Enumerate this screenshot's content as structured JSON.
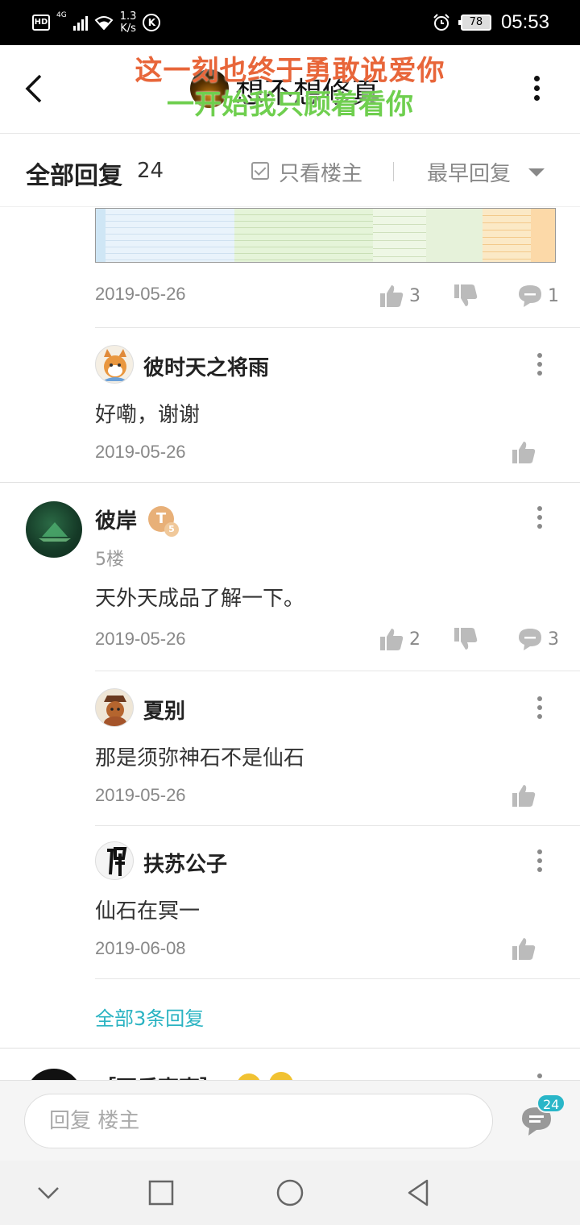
{
  "status_bar": {
    "hd": "HD",
    "network": "4G",
    "speed_value": "1.3",
    "speed_unit": "K/s",
    "k_icon": "K",
    "battery": "78",
    "time": "05:53"
  },
  "header": {
    "title": "想不想修真",
    "lyric_line1": "这一刻也终于勇敢说爱你",
    "lyric_line2": "一开始我只顾着看你"
  },
  "filter": {
    "title": "全部回复",
    "count": "24",
    "only_op_label": "只看楼主",
    "sort_label": "最早回复"
  },
  "posts": [
    {
      "date": "2019-05-26",
      "likes": "3",
      "comments": "1"
    },
    {
      "username": "彼时天之将雨",
      "text": "好嘞，谢谢",
      "date": "2019-05-26"
    },
    {
      "username": "彼岸",
      "badge": "T",
      "badge_level": "5",
      "floor": "5楼",
      "text": "天外天成品了解一下。",
      "date": "2019-05-26",
      "likes": "2",
      "comments": "3"
    },
    {
      "username": "夏别",
      "text": "那是须弥神石不是仙石",
      "date": "2019-05-26"
    },
    {
      "username": "扶苏公子",
      "text": "仙石在冥一",
      "date": "2019-06-08"
    },
    {
      "all_replies": "全部3条回复"
    },
    {
      "username": "［不乐事事］"
    }
  ],
  "bottom": {
    "placeholder": "回复  楼主",
    "reply_count": "24"
  },
  "icons": {
    "back": "back-arrow-icon",
    "more": "more-vertical-icon",
    "thumbs_up": "thumbs-up-icon",
    "thumbs_down": "thumbs-down-icon",
    "comment": "comment-bubble-icon",
    "nav_back": "nav-back-icon",
    "nav_home": "nav-home-icon",
    "nav_recent": "nav-recent-icon",
    "nav_down": "nav-collapse-icon"
  },
  "colors": {
    "accent": "#2ab3c2",
    "lyric1": "#e8663a",
    "lyric2": "#6fcf4f"
  }
}
